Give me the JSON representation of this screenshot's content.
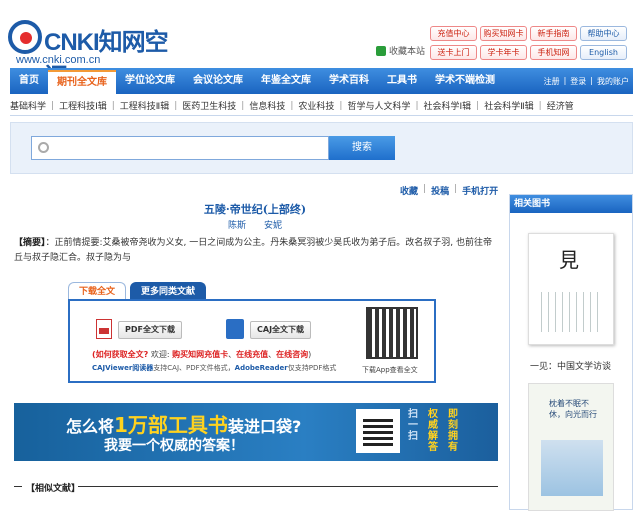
{
  "header": {
    "logo_cnki": "CNKI",
    "logo_site": "知网空间",
    "logo_url": "www.cnki.com.cn",
    "favorite": "收藏本站",
    "buttons": [
      "充值中心",
      "购买知网卡",
      "新手指南",
      "帮助中心",
      "送卡上门",
      "学卡年卡",
      "手机知网",
      "English"
    ]
  },
  "nav": {
    "items": [
      "首页",
      "期刊全文库",
      "学位论文库",
      "会议论文库",
      "年鉴全文库",
      "学术百科",
      "工具书",
      "学术不端检测"
    ],
    "active_index": 1,
    "right": [
      "注册",
      "登录",
      "我的账户"
    ]
  },
  "subnav": {
    "items": [
      "基础科学",
      "工程科技Ⅰ辑",
      "工程科技Ⅱ辑",
      "医药卫生科技",
      "信息科技",
      "农业科技",
      "哲学与人文科学",
      "社会科学Ⅰ辑",
      "社会科学Ⅱ辑",
      "经济管"
    ]
  },
  "search": {
    "placeholder": "",
    "button": "搜索"
  },
  "tools": [
    "收藏",
    "投稿",
    "手机打开"
  ],
  "article": {
    "title": "五陵·帝世纪(上部终)",
    "authors": "陈斯　　安妮",
    "abstract_label": "【摘要】",
    "abstract": "：正前情提要:艾桑被帝尧收为义女, 一日之间成为公主。丹朱桑冥羽被少昊氏收为弟子后。改名叔子羽, 也前往帝丘与叔子隐汇合。叔子隐为与"
  },
  "download": {
    "tab_full": "下载全文",
    "tab_more": "更多同类文献",
    "pdf_button": "PDF全文下载",
    "caj_button": "CAJ全文下载",
    "how_label": "(如何获取全文?",
    "welcome": "欢迎:",
    "links": [
      "购买知网充值卡",
      "在线充值",
      "在线咨询"
    ],
    "how_sep1": "、",
    "how_sep2": "、",
    "how_end": ")",
    "note_caj": "CAJViewer阅读器",
    "note_mid": "支持CAJ、PDF文件格式，",
    "note_adobe": "AdobeReader",
    "note_end": "仅支持PDF格式",
    "qr_caption": "下载App查看全文"
  },
  "banner": {
    "line1_a": "怎么将",
    "line1_b": "1万部工具书",
    "line1_c": "装进口袋?",
    "line2": "我要一个权威的答案！",
    "vert1": "扫一扫",
    "vert2": "权威解答",
    "vert3": "即刻拥有"
  },
  "similar": "【相似文献】",
  "sidebar": {
    "title": "相关图书",
    "book1_glyph": "見",
    "book1_caption": "一见：中国文学访谈",
    "book2_title": "枕着不眠不休，向光而行"
  },
  "colors": {
    "brand_blue": "#1d5ba8",
    "accent_orange": "#e8621b",
    "link_red": "#d22222"
  }
}
